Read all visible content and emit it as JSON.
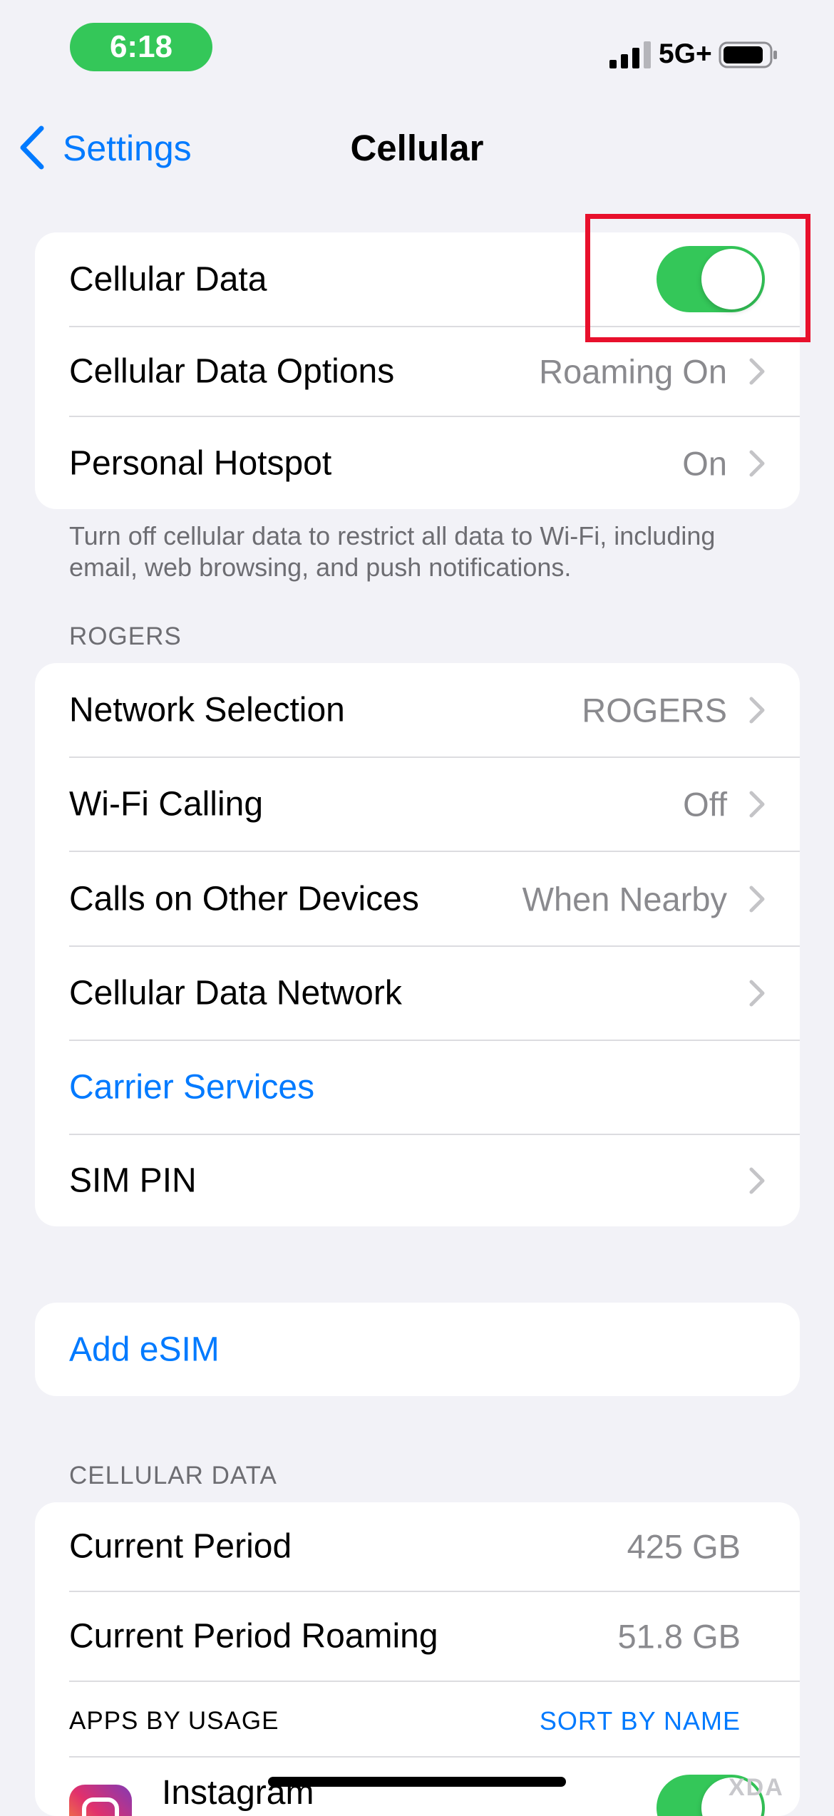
{
  "status_bar": {
    "time": "6:18",
    "network": "5G+"
  },
  "nav": {
    "back_label": "Settings",
    "title": "Cellular"
  },
  "group1": {
    "cellular_data_label": "Cellular Data",
    "cellular_data_on": true,
    "data_options_label": "Cellular Data Options",
    "data_options_value": "Roaming On",
    "hotspot_label": "Personal Hotspot",
    "hotspot_value": "On"
  },
  "group1_footer": "Turn off cellular data to restrict all data to Wi-Fi, including email, web browsing, and push notifications.",
  "carrier_header": "ROGERS",
  "group2": {
    "network_selection_label": "Network Selection",
    "network_selection_value": "ROGERS",
    "wifi_calling_label": "Wi-Fi Calling",
    "wifi_calling_value": "Off",
    "other_devices_label": "Calls on Other Devices",
    "other_devices_value": "When Nearby",
    "data_network_label": "Cellular Data Network",
    "carrier_services_label": "Carrier Services",
    "sim_pin_label": "SIM PIN"
  },
  "group3": {
    "add_esim_label": "Add eSIM"
  },
  "usage_header": "CELLULAR DATA",
  "group4": {
    "current_period_label": "Current Period",
    "current_period_value": "425 GB",
    "roaming_label": "Current Period Roaming",
    "roaming_value": "51.8 GB",
    "apps_by_usage_label": "APPS BY USAGE",
    "sort_label": "SORT BY NAME",
    "app1_name": "Instagram",
    "app1_enabled": true
  },
  "watermark": "XDA",
  "colors": {
    "accent": "#007aff",
    "toggle_on": "#34c759",
    "highlight": "#e8102c",
    "background": "#f2f2f7"
  }
}
